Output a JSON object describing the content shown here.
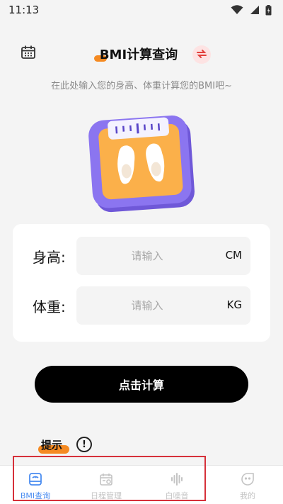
{
  "status_bar": {
    "time": "11:13",
    "icons": [
      "wifi-icon",
      "signal-icon",
      "battery-icon"
    ]
  },
  "header": {
    "title": "BMI计算查询",
    "subtitle": "在此处输入您的身高、体重计算您的BMI吧~",
    "left_icon": "calendar-icon",
    "right_icon": "switch-icon"
  },
  "form": {
    "height": {
      "label": "身高:",
      "placeholder": "请输入",
      "value": "",
      "unit": "CM"
    },
    "weight": {
      "label": "体重:",
      "placeholder": "请输入",
      "value": "",
      "unit": "KG"
    }
  },
  "calculate_button": {
    "label": "点击计算"
  },
  "tips": {
    "label": "提示",
    "icon": "info-icon",
    "icon_glyph": "!"
  },
  "bottom_nav": {
    "items": [
      {
        "label": "BMI查询",
        "icon": "scale-icon",
        "active": true
      },
      {
        "label": "日程管理",
        "icon": "calendar-icon",
        "active": false
      },
      {
        "label": "白噪音",
        "icon": "sound-wave-icon",
        "active": false
      },
      {
        "label": "我的",
        "icon": "profile-icon",
        "active": false
      }
    ]
  },
  "colors": {
    "accent_orange": "#f58a22",
    "active_blue": "#4a8cf0",
    "scale_purple": "#8b75f0",
    "scale_orange": "#fbb04a",
    "highlight_red": "#d6303a"
  }
}
